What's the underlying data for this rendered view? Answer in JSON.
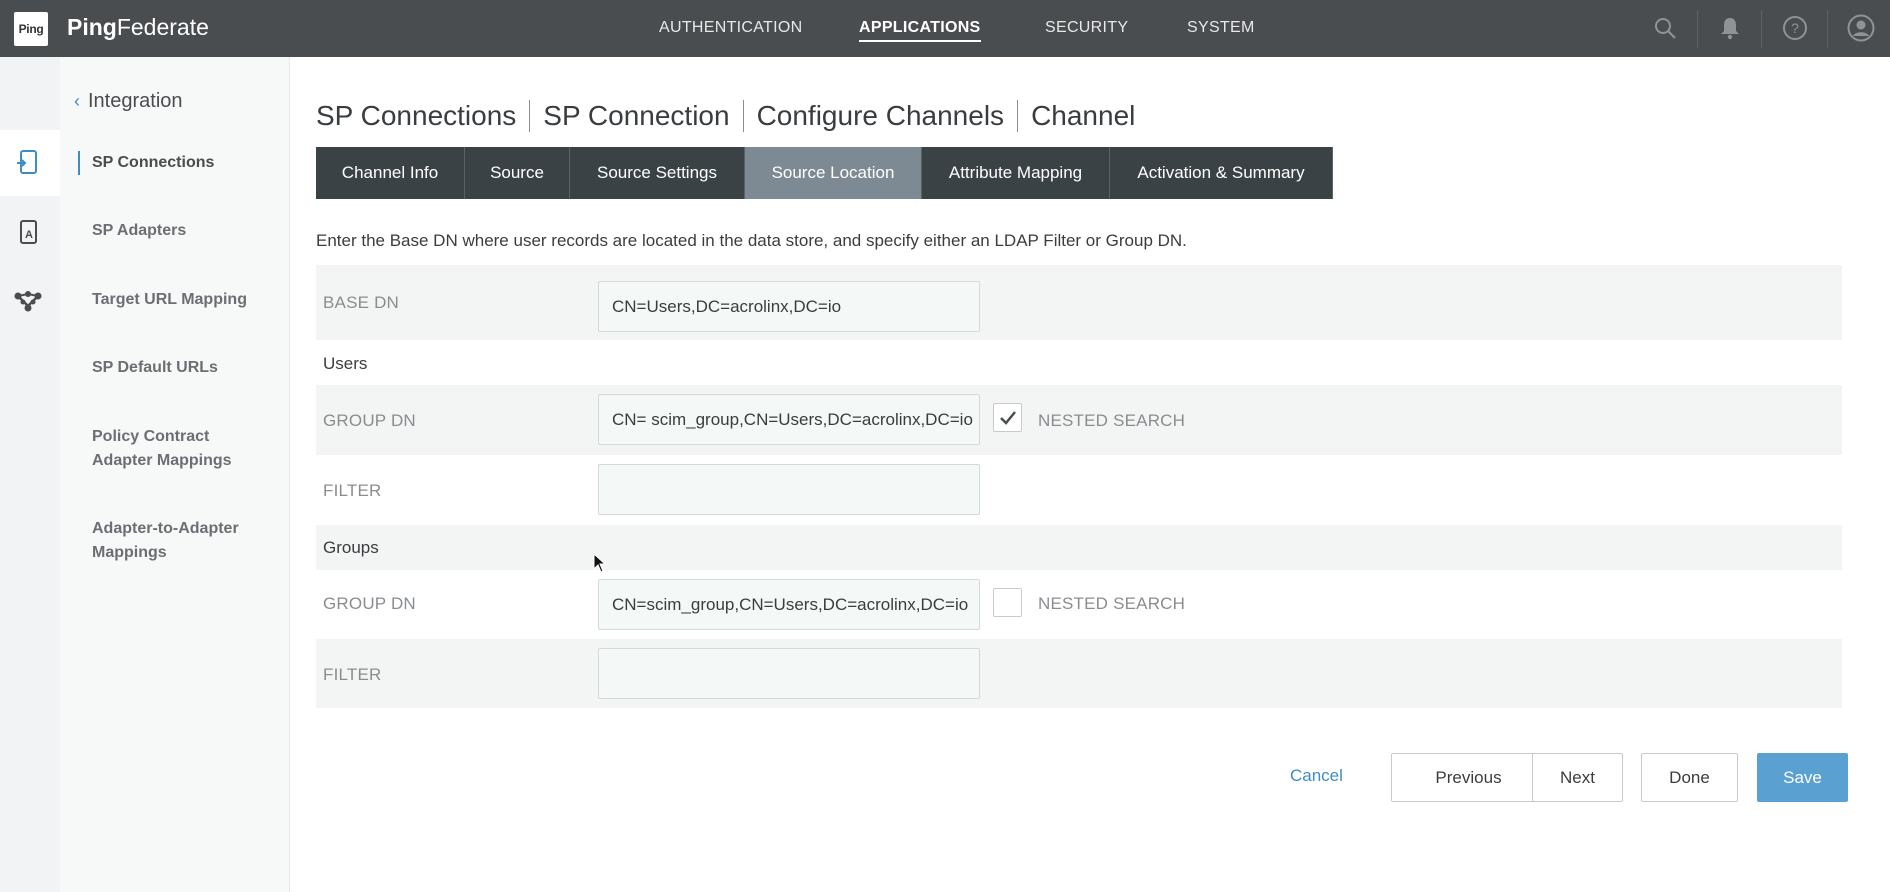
{
  "app": {
    "logo_text": "Ping",
    "product_bold": "Ping",
    "product_light": "Federate"
  },
  "top_nav": [
    {
      "label": "AUTHENTICATION",
      "active": false
    },
    {
      "label": "APPLICATIONS",
      "active": true
    },
    {
      "label": "SECURITY",
      "active": false
    },
    {
      "label": "SYSTEM",
      "active": false
    }
  ],
  "top_icons": [
    "search-icon",
    "bell-icon",
    "help-icon",
    "user-icon"
  ],
  "rail_icons": [
    "sp-connection-icon",
    "adapter-icon",
    "network-icon"
  ],
  "sidebar": {
    "header": "Integration",
    "items": [
      {
        "label": "SP Connections",
        "active": true
      },
      {
        "label": "SP Adapters",
        "active": false
      },
      {
        "label": "Target URL Mapping",
        "active": false
      },
      {
        "label": "SP Default URLs",
        "active": false
      },
      {
        "label": "Policy Contract Adapter Mappings",
        "active": false
      },
      {
        "label": "Adapter-to-Adapter Mappings",
        "active": false
      }
    ]
  },
  "breadcrumb": [
    "SP Connections",
    "SP Connection",
    "Configure Channels",
    "Channel"
  ],
  "tabs": [
    {
      "label": "Channel Info",
      "active": false
    },
    {
      "label": "Source",
      "active": false
    },
    {
      "label": "Source Settings",
      "active": false
    },
    {
      "label": "Source Location",
      "active": true
    },
    {
      "label": "Attribute Mapping",
      "active": false
    },
    {
      "label": "Activation & Summary",
      "active": false
    }
  ],
  "instructions": "Enter the Base DN where user records are located in the data store, and specify either an LDAP Filter or Group DN.",
  "form": {
    "base_dn": {
      "label": "BASE DN",
      "value": "CN=Users,DC=acrolinx,DC=io"
    },
    "users": {
      "section_label": "Users",
      "group_dn": {
        "label": "GROUP DN",
        "value": "CN= scim_group,CN=Users,DC=acrolinx,DC=io"
      },
      "nested_search": {
        "label": "NESTED SEARCH",
        "checked": true
      },
      "filter": {
        "label": "FILTER",
        "value": ""
      }
    },
    "groups": {
      "section_label": "Groups",
      "group_dn": {
        "label": "GROUP DN",
        "value": "CN=scim_group,CN=Users,DC=acrolinx,DC=io"
      },
      "nested_search": {
        "label": "NESTED SEARCH",
        "checked": false
      },
      "filter": {
        "label": "FILTER",
        "value": ""
      }
    }
  },
  "footer": {
    "cancel": "Cancel",
    "previous": "Previous",
    "next": "Next",
    "done": "Done",
    "save": "Save"
  },
  "colors": {
    "topbar": "#4a4d50",
    "tab_dark": "#3b4246",
    "tab_active": "#7e8a93",
    "accent": "#3f8ec2",
    "save_button": "#5aa0d0"
  }
}
